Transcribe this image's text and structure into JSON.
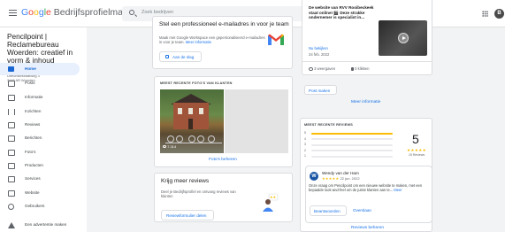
{
  "header": {
    "logo": {
      "g1": "G",
      "o1": "o",
      "o2": "o",
      "g2": "g",
      "l": "l",
      "e": "e",
      "product": " Bedrijfsprofielmanager"
    },
    "search_placeholder": "Zoek bedrijven",
    "avatar_letter": "B"
  },
  "business": {
    "name": "Pencilpoint | Reclamebureau Woerden: creatief in vorm & inhoud",
    "address_line1": "Utrechtsestraatweg 3",
    "address_line2": "3445 AR Woerden"
  },
  "sidebar": {
    "items": [
      {
        "label": "Home",
        "icon": "home-icon",
        "active": true
      },
      {
        "label": "Posts",
        "icon": "posts-icon"
      },
      {
        "label": "Informatie",
        "icon": "info-icon"
      },
      {
        "label": "Inzichten",
        "icon": "insights-icon"
      },
      {
        "label": "Reviews",
        "icon": "reviews-icon"
      },
      {
        "label": "Berichten",
        "icon": "messages-icon"
      },
      {
        "label": "Foto's",
        "icon": "photos-icon"
      },
      {
        "label": "Producten",
        "icon": "products-icon"
      },
      {
        "label": "Services",
        "icon": "services-icon"
      },
      {
        "label": "Website",
        "icon": "website-icon"
      },
      {
        "label": "Gebruikers",
        "icon": "users-icon"
      },
      {
        "label": "Een advertentie maken",
        "icon": "ads-icon"
      }
    ]
  },
  "promo": {
    "heading": "Stel een professioneel e-mailadres in voor je team",
    "text": "Maak met Google Workspace een gepersonaliseerd e-mailadres in voor je team.",
    "more_link": "Meer informatie",
    "button": "Aan de slag"
  },
  "photos": {
    "title": "Meest recente foto's van klanten",
    "count": "7.314",
    "manage_link": "Foto's beheren"
  },
  "get_reviews": {
    "heading": "Krijg meer reviews",
    "text": "Deel je Bedrijfsprofiel en ontvang reviews van klanten",
    "button": "Reviewformulier delen"
  },
  "post": {
    "title": "De website van RVV Rooibeckeek staat online! 🎬 Deze strakke ondernemer is specialist in...",
    "more_link": "Nu bekijken",
    "date": "24 feb. 2022",
    "views": "3 weergaven",
    "clicks": "0 klikken",
    "create_button": "Post maken",
    "more_info_link": "Meer informatie"
  },
  "recent_reviews": {
    "title": "Meest recente reviews",
    "average": "5",
    "stars": "★★★★★",
    "count": "15 Reviews",
    "distribution": [
      {
        "star": "5",
        "fraction": 1.0
      },
      {
        "star": "4",
        "fraction": 0.0
      },
      {
        "star": "3",
        "fraction": 0.0
      },
      {
        "star": "2",
        "fraction": 0.0
      },
      {
        "star": "1",
        "fraction": 0.0
      }
    ],
    "review": {
      "avatar_letter": "W",
      "author": "Wendy van der Ham",
      "stars": "★★★★★",
      "date": "22 jun. 2022",
      "text": "Onze vraag om Pencilpoint om een nieuwe website te maken, met een bepaalde look-and-feel om de juiste klanten aan te...",
      "more_link": "Meer",
      "reply_button": "Beantwoorden",
      "skip_button": "Overslaan"
    },
    "manage_link": "Reviews beheren"
  },
  "colors": {
    "accent": "#1a73e8",
    "star": "#fbbc04",
    "active_bg": "#e8f0fe"
  }
}
